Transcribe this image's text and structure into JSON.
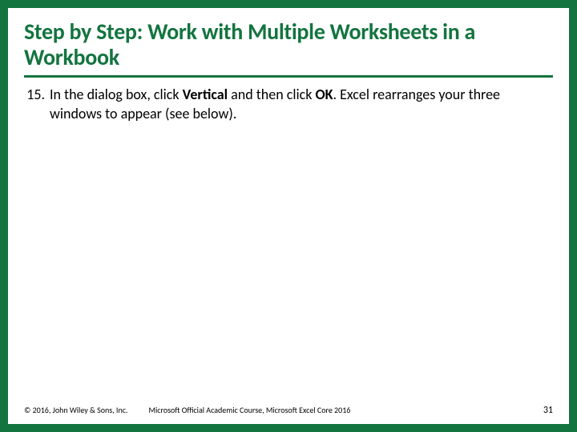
{
  "title": "Step by Step: Work with Multiple Worksheets in a Workbook",
  "step": {
    "number": "15.",
    "pre": "In the dialog box, click ",
    "bold1": "Vertical",
    "mid": " and then click ",
    "bold2": "OK",
    "post": ". Excel rearranges your three windows to appear (see below)."
  },
  "footer": {
    "copyright": "© 2016, John Wiley & Sons, Inc.",
    "course": "Microsoft Official Academic Course, Microsoft Excel Core 2016",
    "page": "31"
  }
}
